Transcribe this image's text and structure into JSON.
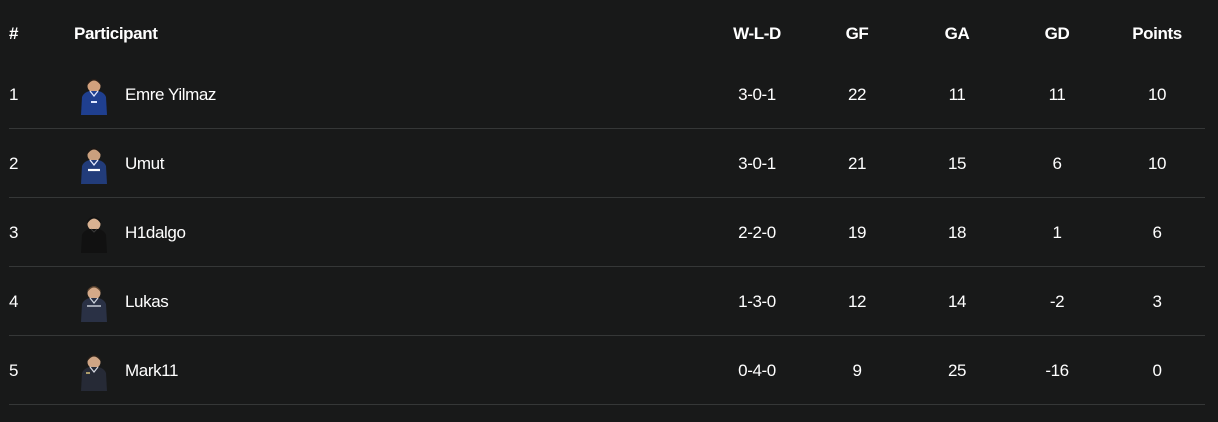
{
  "headers": {
    "rank": "#",
    "participant": "Participant",
    "wld": "W-L-D",
    "gf": "GF",
    "ga": "GA",
    "gd": "GD",
    "points": "Points"
  },
  "rows": [
    {
      "rank": "1",
      "name": "Emre Yilmaz",
      "wld": "3-0-1",
      "gf": "22",
      "ga": "11",
      "gd": "11",
      "points": "10",
      "avatar_icon": "player-avatar-icon",
      "kit_color": "#1f3f8f"
    },
    {
      "rank": "2",
      "name": "Umut",
      "wld": "3-0-1",
      "gf": "21",
      "ga": "15",
      "gd": "6",
      "points": "10",
      "avatar_icon": "player-avatar-icon",
      "kit_color": "#223c7a"
    },
    {
      "rank": "3",
      "name": "H1dalgo",
      "wld": "2-2-0",
      "gf": "19",
      "ga": "18",
      "gd": "1",
      "points": "6",
      "avatar_icon": "player-avatar-icon",
      "kit_color": "#111111"
    },
    {
      "rank": "4",
      "name": "Lukas",
      "wld": "1-3-0",
      "gf": "12",
      "ga": "14",
      "gd": "-2",
      "points": "3",
      "avatar_icon": "player-avatar-icon",
      "kit_color": "#2a3145"
    },
    {
      "rank": "5",
      "name": "Mark11",
      "wld": "0-4-0",
      "gf": "9",
      "ga": "25",
      "gd": "-16",
      "points": "0",
      "avatar_icon": "player-avatar-icon",
      "kit_color": "#262a36"
    }
  ],
  "colors": {
    "background": "#181919",
    "text": "#ffffff",
    "divider": "#353737"
  }
}
